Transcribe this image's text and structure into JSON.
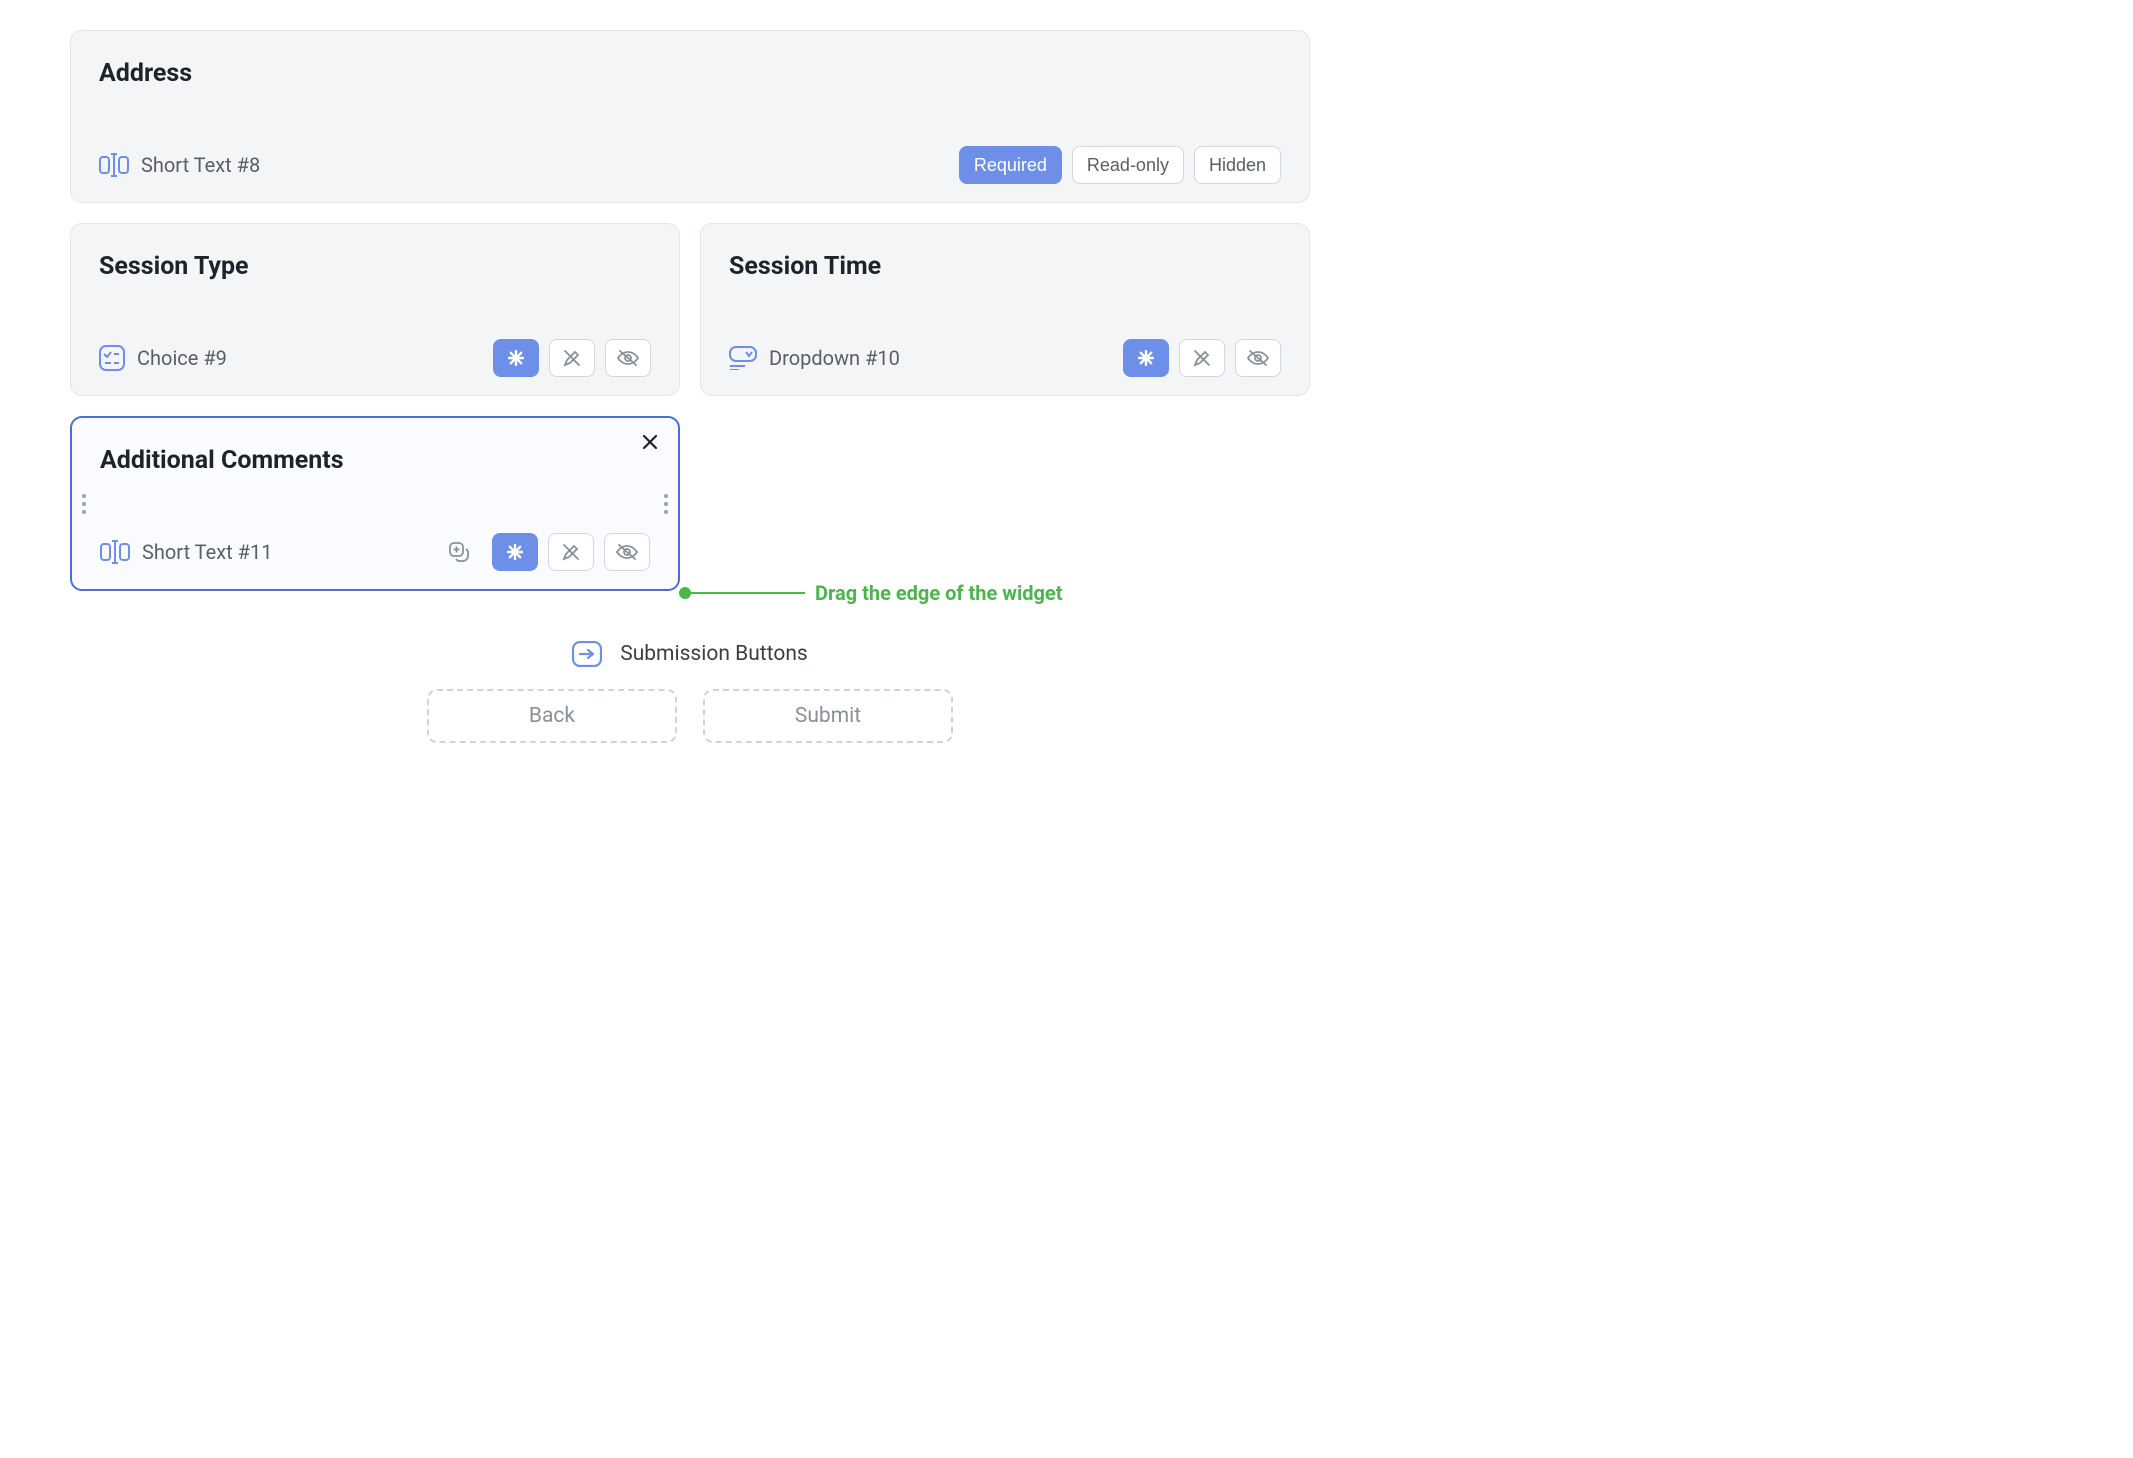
{
  "cards": {
    "address": {
      "title": "Address",
      "field_label": "Short Text #8",
      "pills": {
        "required": "Required",
        "readonly": "Read-only",
        "hidden": "Hidden"
      }
    },
    "session_type": {
      "title": "Session Type",
      "field_label": "Choice #9"
    },
    "session_time": {
      "title": "Session Time",
      "field_label": "Dropdown #10"
    },
    "comments": {
      "title": "Additional Comments",
      "field_label": "Short Text #11"
    }
  },
  "annotation": "Drag the edge of the widget",
  "submission": {
    "heading": "Submission Buttons",
    "back": "Back",
    "submit": "Submit"
  }
}
